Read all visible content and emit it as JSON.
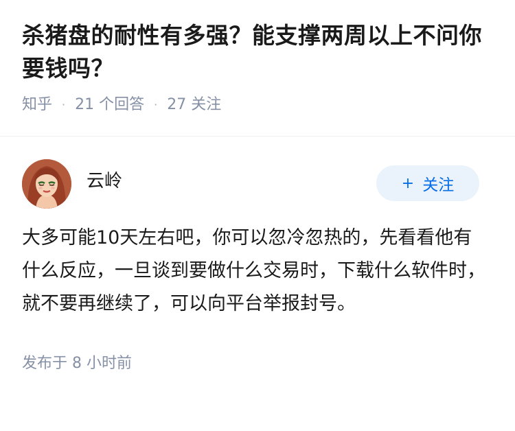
{
  "question": {
    "title": "杀猪盘的耐性有多强？能支撑两周以上不问你要钱吗？",
    "source": "知乎",
    "separator": "·",
    "answers_count": "21 个回答",
    "followers_count": "27 关注"
  },
  "answer": {
    "author": {
      "name": "云岭",
      "avatar_icon": "avatar-illustrated-woman"
    },
    "follow_button": {
      "icon": "plus-icon",
      "icon_glyph": "+",
      "label": "关注"
    },
    "content": "大多可能10天左右吧，你可以忽冷忽热的，先看看他有什么反应，一旦谈到要做什么交易时，下载什么软件时，就不要再继续了，可以向平台举报封号。",
    "published": "发布于 8 小时前"
  },
  "colors": {
    "title": "#1a1a1a",
    "meta": "#8590a6",
    "accent": "#056de8",
    "button_bg": "#eaf2fc",
    "divider": "#eff1f4"
  }
}
